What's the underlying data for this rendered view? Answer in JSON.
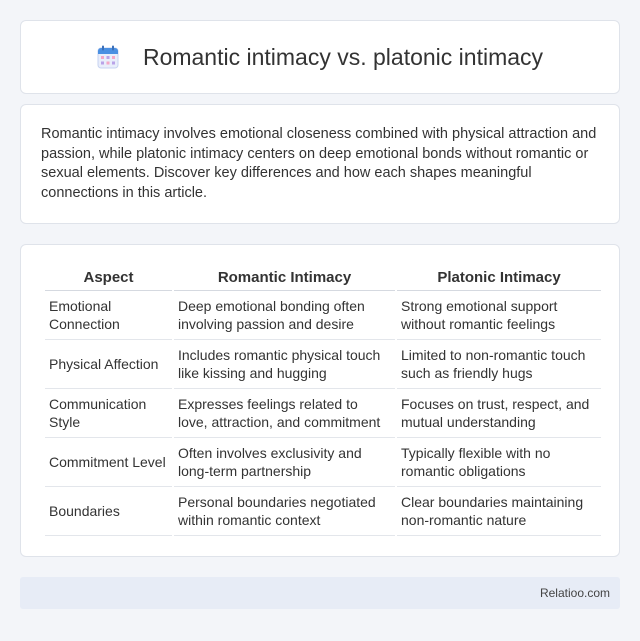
{
  "header": {
    "icon": "calendar-icon",
    "title": "Romantic intimacy vs. platonic intimacy"
  },
  "intro": {
    "text": "Romantic intimacy involves emotional closeness combined with physical attraction and passion, while platonic intimacy centers on deep emotional bonds without romantic or sexual elements. Discover key differences and how each shapes meaningful connections in this article."
  },
  "table": {
    "headers": [
      "Aspect",
      "Romantic Intimacy",
      "Platonic Intimacy"
    ],
    "rows": [
      [
        "Emotional Connection",
        "Deep emotional bonding often involving passion and desire",
        "Strong emotional support without romantic feelings"
      ],
      [
        "Physical Affection",
        "Includes romantic physical touch like kissing and hugging",
        "Limited to non-romantic touch such as friendly hugs"
      ],
      [
        "Communication Style",
        "Expresses feelings related to love, attraction, and commitment",
        "Focuses on trust, respect, and mutual understanding"
      ],
      [
        "Commitment Level",
        "Often involves exclusivity and long-term partnership",
        "Typically flexible with no romantic obligations"
      ],
      [
        "Boundaries",
        "Personal boundaries negotiated within romantic context",
        "Clear boundaries maintaining non-romantic nature"
      ]
    ]
  },
  "footer": {
    "site": "Relatioo.com"
  },
  "colors": {
    "background": "#f3f5f9",
    "card": "#ffffff",
    "footer_bg": "#e7ecf6",
    "icon_blue": "#4a90e2",
    "icon_pink": "#f4a7c6"
  }
}
